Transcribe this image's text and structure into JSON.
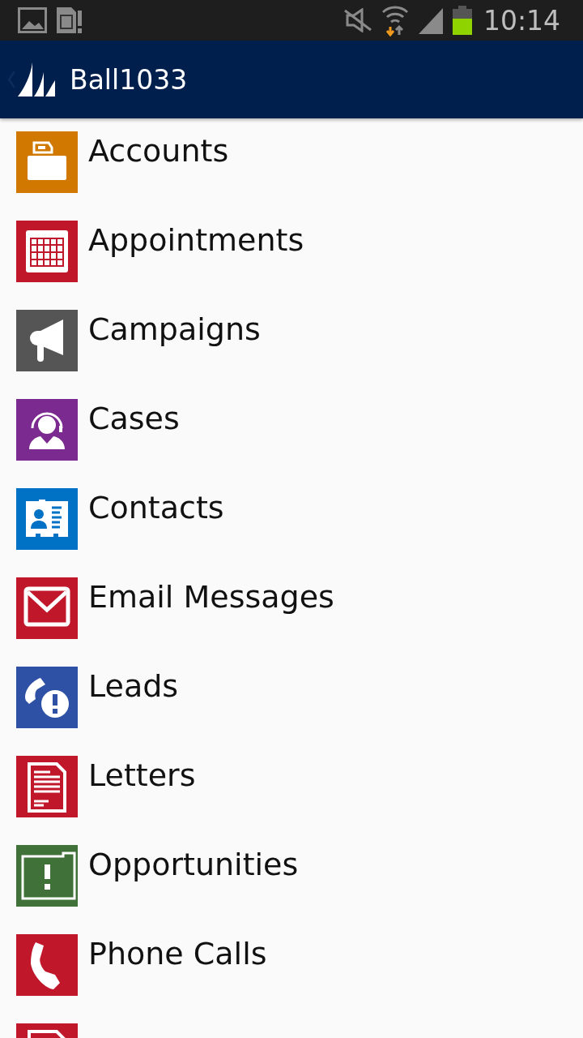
{
  "status_bar": {
    "time": "10:14"
  },
  "header": {
    "title": "Ball1033"
  },
  "items": [
    {
      "label": "Accounts",
      "kind": "folder",
      "color": "#d07800"
    },
    {
      "label": "Appointments",
      "kind": "calendar",
      "color": "#c0172b"
    },
    {
      "label": "Campaigns",
      "kind": "megaphone",
      "color": "#555555"
    },
    {
      "label": "Cases",
      "kind": "headset",
      "color": "#7b2a8f"
    },
    {
      "label": "Contacts",
      "kind": "card",
      "color": "#0072c6"
    },
    {
      "label": "Email Messages",
      "kind": "mail",
      "color": "#c0172b"
    },
    {
      "label": "Leads",
      "kind": "lead",
      "color": "#2f51a5"
    },
    {
      "label": "Letters",
      "kind": "letter",
      "color": "#c0172b"
    },
    {
      "label": "Opportunities",
      "kind": "opportunity",
      "color": "#3f7138"
    },
    {
      "label": "Phone Calls",
      "kind": "phone",
      "color": "#c0172b"
    },
    {
      "kind": "letter",
      "color": "#c0172b"
    }
  ]
}
